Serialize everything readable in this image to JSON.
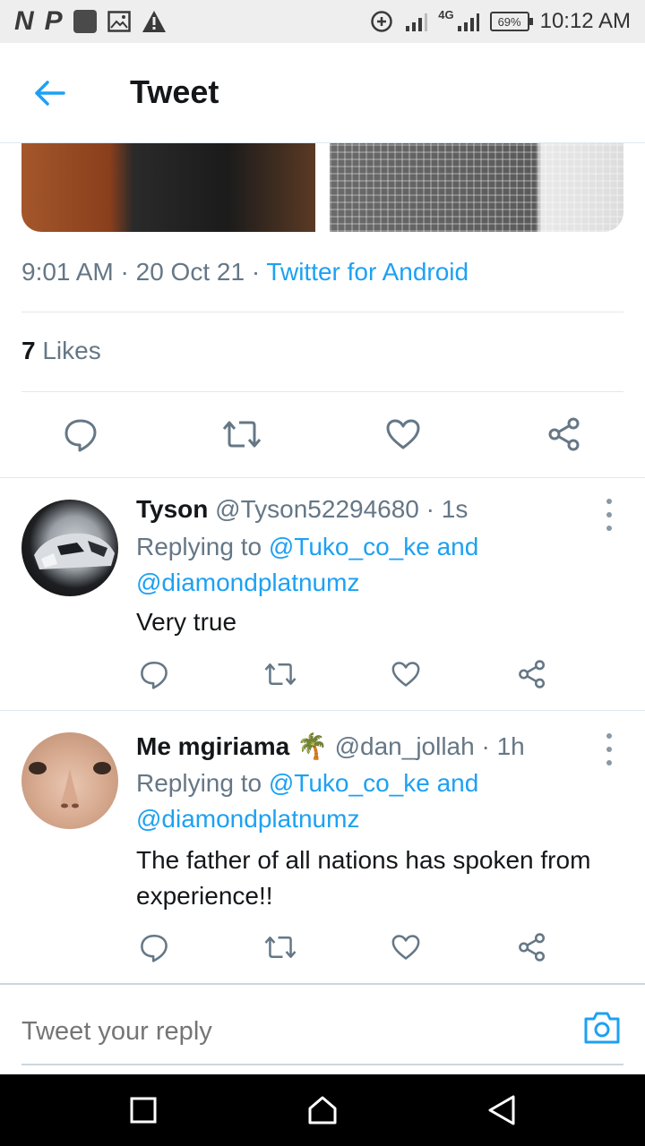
{
  "status_bar": {
    "left_glyphs": [
      "N",
      "P"
    ],
    "network": "4G",
    "battery": "69%",
    "time": "10:12 AM"
  },
  "header": {
    "title": "Tweet",
    "back_icon": "arrow-left-icon"
  },
  "tweet": {
    "time": "9:01 AM",
    "date": "20 Oct 21",
    "separator": "·",
    "source": "Twitter for Android",
    "likes_count": "7",
    "likes_label": "Likes"
  },
  "replies": [
    {
      "name": "Tyson",
      "emoji": "",
      "handle": "@Tyson52294680",
      "time": "· 1s",
      "replying_prefix": "Replying to",
      "mention1": "@Tuko_co_ke",
      "and": "and",
      "mention2": "@diamondplatnumz",
      "text": "Very true"
    },
    {
      "name": "Me mgiriama",
      "emoji": "🌴",
      "handle": "@dan_jollah",
      "time": "· 1h",
      "replying_prefix": "Replying to",
      "mention1": "@Tuko_co_ke",
      "and": "and",
      "mention2": "@diamondplatnumz",
      "text": "The father of all nations has spoken from experience!!"
    }
  ],
  "composer": {
    "placeholder": "Tweet your reply"
  },
  "colors": {
    "accent": "#1da1f2",
    "secondary_text": "#657786",
    "primary_text": "#14171a",
    "divider": "#e1e8ed"
  }
}
